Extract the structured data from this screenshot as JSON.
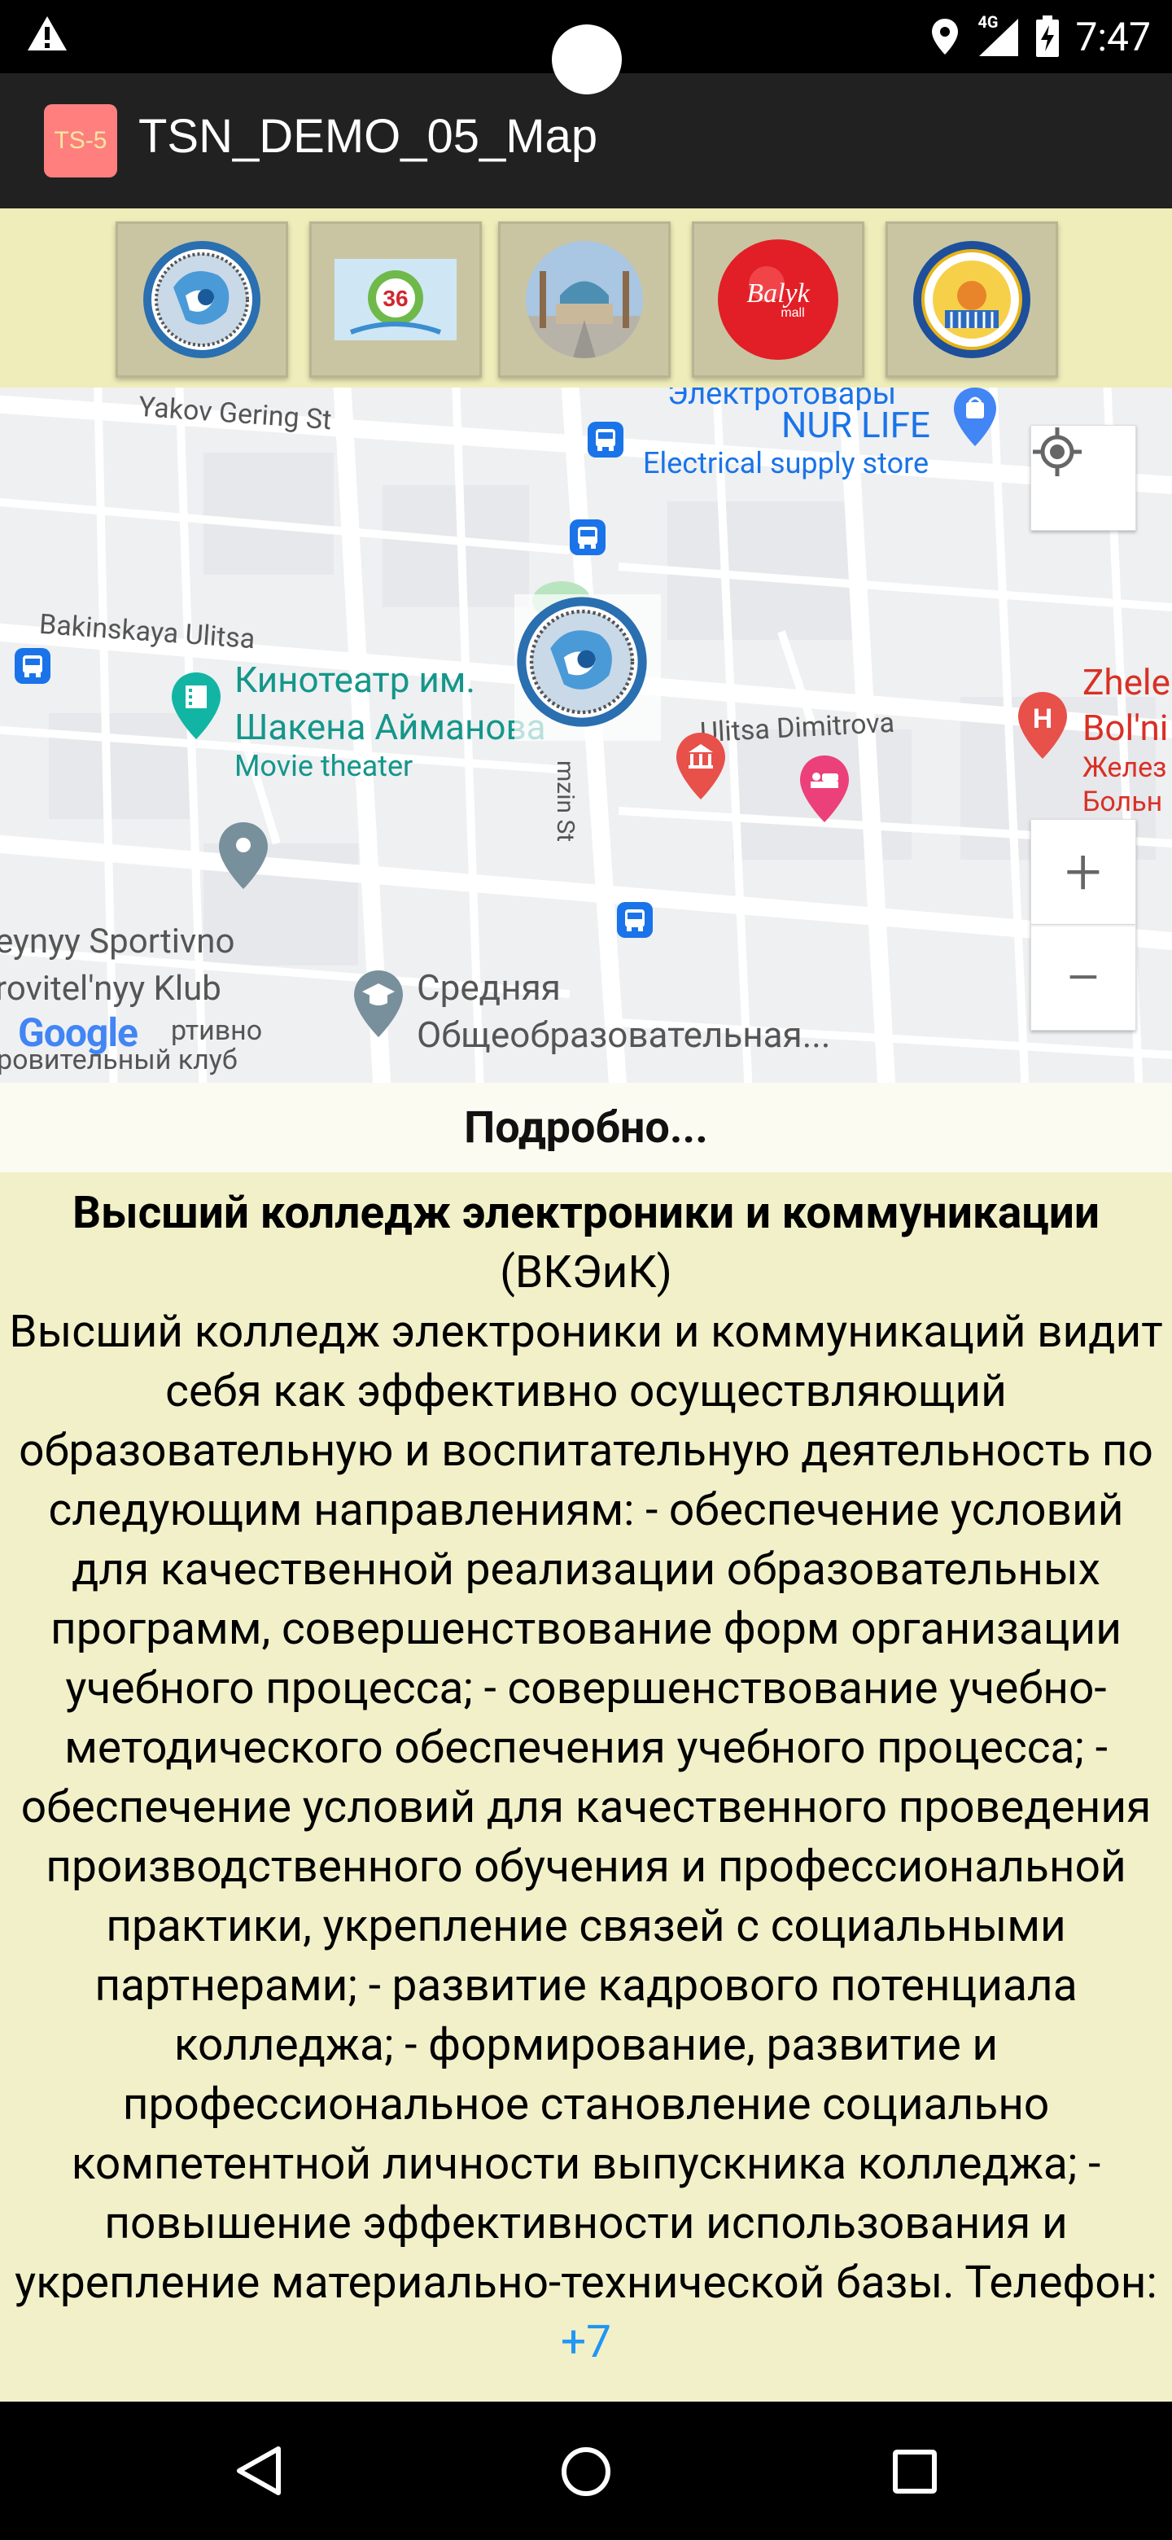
{
  "status_bar": {
    "time": "7:47",
    "network": "4G"
  },
  "app": {
    "icon_text": "TS-5",
    "title": "TSN_DEMO_05_Map"
  },
  "logos": [
    {
      "name": "college-logo"
    },
    {
      "name": "school-36-logo"
    },
    {
      "name": "mosque-photo"
    },
    {
      "name": "balyk-mall-logo",
      "text": "Balyk",
      "subtext": "mall"
    },
    {
      "name": "regional-emblem"
    }
  ],
  "map": {
    "streets": {
      "yakov_gering": "Yakov Gering St",
      "bakinskaya": "Bakinskaya Ulitsa",
      "dimitrova": "Ulitsa Dimitrova",
      "kuzmin": "mzin St"
    },
    "pois": {
      "nur_life_top": "Электротовары",
      "nur_life": "NUR LIFE",
      "nur_life_type": "Electrical supply store",
      "cinema_line1": "Кинотеатр им.",
      "cinema_line2": "Шакена Айманова",
      "cinema_type": "Movie theater",
      "hospital_line1": "Zhele",
      "hospital_line2": "Bol'ni",
      "hospital_line3": "Желез",
      "hospital_line4": "Больн",
      "club_line1": "eynyy Sportivno",
      "club_line2": "rovitel'nyy Klub",
      "club_line3": "ртивно",
      "club_line4": "ровительный клуб",
      "school_line1": "Средняя",
      "school_line2": "Общеобразовательная..."
    },
    "google": "Google",
    "zoom_in": "+",
    "zoom_out": "−"
  },
  "details": {
    "header": "Подробно..."
  },
  "description": {
    "name_bold": "Высший колледж электроники и коммуникации",
    "abbr": " (ВКЭиК)",
    "body": "Высший колледж электроники и коммуникаций видит себя как эффективно осуществляющий образовательную и воспитательную деятельность по следующим направлениям: - обеспечение условий для качественной реализации образовательных программ, совершенствование форм организации учебного процесса; - совершенствование учебно-методического обеспечения учебного процесса; - обеспечение условий для качественного проведения производственного обучения и профессиональной практики, укрепление связей с социальными партнерами; - развитие кадрового потенциала колледжа; - формирование, развитие и профессиональное становление социально компетентной личности выпускника колледжа; - повышение эффективности использования и укрепление материально-технической базы. Телефон: ",
    "phone": "+7"
  }
}
